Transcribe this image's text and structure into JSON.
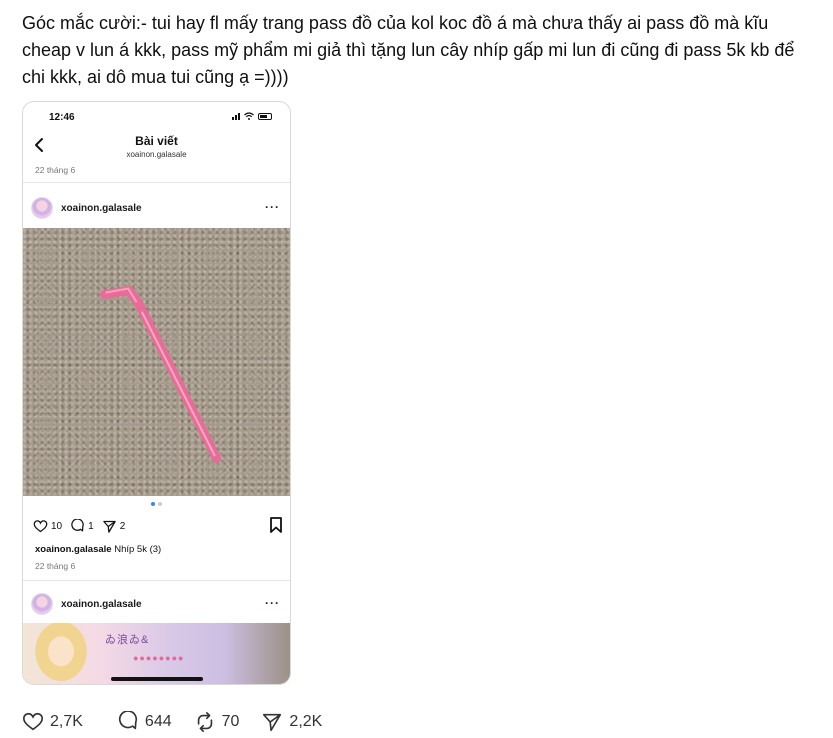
{
  "post": {
    "text": "Góc mắc cười:- tui hay fl mấy trang pass đồ của kol koc đồ á mà chưa thấy ai pass đồ mà kĩu cheap v lun á kkk, pass mỹ phẩm mi giả thì tặng lun cây nhíp gấp mi lun đi cũng đi pass 5k kb để chi kkk, ai dô mua tui cũng ạ =))))"
  },
  "screenshot": {
    "status_time": "12:46",
    "nav_title": "Bài viết",
    "nav_subtitle": "xoainon.galasale",
    "date_top": "22 tháng 6",
    "username": "xoainon.galasale",
    "more_label": "···",
    "likes": "10",
    "comments": "1",
    "shares": "2",
    "caption_user": "xoainon.galasale",
    "caption_text": " Nhíp 5k (3)",
    "caption_date": "22 tháng 6",
    "username2": "xoainon.galasale",
    "photo2_text": "ゐ浪ゐ&",
    "photo2_dots": "●●●●●●●●"
  },
  "stats": {
    "likes": "2,7K",
    "replies": "644",
    "reposts": "70",
    "shares": "2,2K"
  },
  "colors": {
    "tweezer": "#f07aa3",
    "accent_dot": "#3b82f6"
  },
  "icons": [
    "back-chevron-icon",
    "signal-icon",
    "wifi-icon",
    "battery-icon",
    "more-icon",
    "heart-icon",
    "comment-icon",
    "share-icon",
    "bookmark-icon",
    "repost-icon"
  ]
}
